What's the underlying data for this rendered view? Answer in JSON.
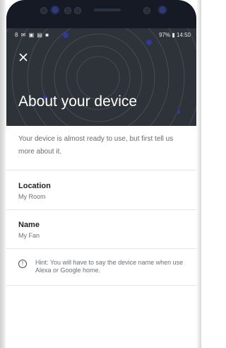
{
  "status_bar": {
    "left_icons": "8 ✉ ▣ ▤ ■",
    "right_text": "97% ▮ 14:50"
  },
  "header": {
    "close_icon": "close-icon",
    "title": "About your device"
  },
  "intro": "Your device is almost ready to use, but first tell us more about it.",
  "fields": [
    {
      "label": "Location",
      "value": "My Room"
    },
    {
      "label": "Name",
      "value": "My Fan"
    }
  ],
  "hint": "Hint: You will have to say the device name when use Alexa or Google home.",
  "colors": {
    "header_bg": "#2e3239",
    "accent": "#2f3a9e"
  }
}
